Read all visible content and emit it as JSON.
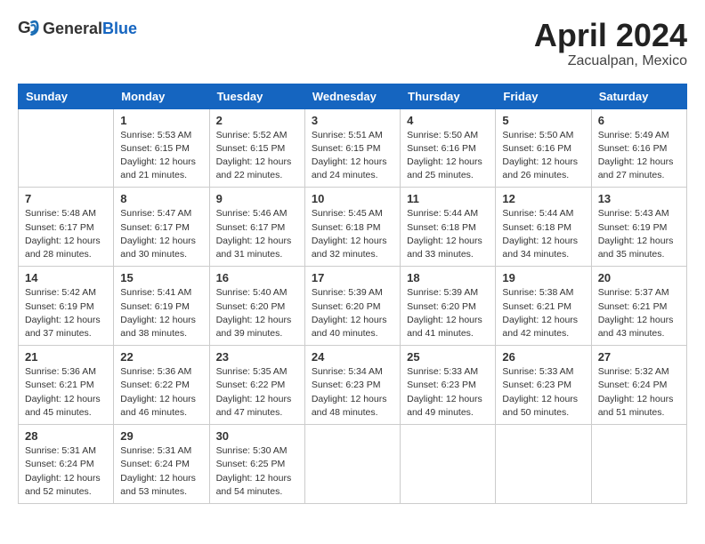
{
  "header": {
    "logo_general": "General",
    "logo_blue": "Blue",
    "month": "April 2024",
    "location": "Zacualpan, Mexico"
  },
  "weekdays": [
    "Sunday",
    "Monday",
    "Tuesday",
    "Wednesday",
    "Thursday",
    "Friday",
    "Saturday"
  ],
  "weeks": [
    [
      {
        "day": "",
        "info": ""
      },
      {
        "day": "1",
        "info": "Sunrise: 5:53 AM\nSunset: 6:15 PM\nDaylight: 12 hours\nand 21 minutes."
      },
      {
        "day": "2",
        "info": "Sunrise: 5:52 AM\nSunset: 6:15 PM\nDaylight: 12 hours\nand 22 minutes."
      },
      {
        "day": "3",
        "info": "Sunrise: 5:51 AM\nSunset: 6:15 PM\nDaylight: 12 hours\nand 24 minutes."
      },
      {
        "day": "4",
        "info": "Sunrise: 5:50 AM\nSunset: 6:16 PM\nDaylight: 12 hours\nand 25 minutes."
      },
      {
        "day": "5",
        "info": "Sunrise: 5:50 AM\nSunset: 6:16 PM\nDaylight: 12 hours\nand 26 minutes."
      },
      {
        "day": "6",
        "info": "Sunrise: 5:49 AM\nSunset: 6:16 PM\nDaylight: 12 hours\nand 27 minutes."
      }
    ],
    [
      {
        "day": "7",
        "info": "Sunrise: 5:48 AM\nSunset: 6:17 PM\nDaylight: 12 hours\nand 28 minutes."
      },
      {
        "day": "8",
        "info": "Sunrise: 5:47 AM\nSunset: 6:17 PM\nDaylight: 12 hours\nand 30 minutes."
      },
      {
        "day": "9",
        "info": "Sunrise: 5:46 AM\nSunset: 6:17 PM\nDaylight: 12 hours\nand 31 minutes."
      },
      {
        "day": "10",
        "info": "Sunrise: 5:45 AM\nSunset: 6:18 PM\nDaylight: 12 hours\nand 32 minutes."
      },
      {
        "day": "11",
        "info": "Sunrise: 5:44 AM\nSunset: 6:18 PM\nDaylight: 12 hours\nand 33 minutes."
      },
      {
        "day": "12",
        "info": "Sunrise: 5:44 AM\nSunset: 6:18 PM\nDaylight: 12 hours\nand 34 minutes."
      },
      {
        "day": "13",
        "info": "Sunrise: 5:43 AM\nSunset: 6:19 PM\nDaylight: 12 hours\nand 35 minutes."
      }
    ],
    [
      {
        "day": "14",
        "info": "Sunrise: 5:42 AM\nSunset: 6:19 PM\nDaylight: 12 hours\nand 37 minutes."
      },
      {
        "day": "15",
        "info": "Sunrise: 5:41 AM\nSunset: 6:19 PM\nDaylight: 12 hours\nand 38 minutes."
      },
      {
        "day": "16",
        "info": "Sunrise: 5:40 AM\nSunset: 6:20 PM\nDaylight: 12 hours\nand 39 minutes."
      },
      {
        "day": "17",
        "info": "Sunrise: 5:39 AM\nSunset: 6:20 PM\nDaylight: 12 hours\nand 40 minutes."
      },
      {
        "day": "18",
        "info": "Sunrise: 5:39 AM\nSunset: 6:20 PM\nDaylight: 12 hours\nand 41 minutes."
      },
      {
        "day": "19",
        "info": "Sunrise: 5:38 AM\nSunset: 6:21 PM\nDaylight: 12 hours\nand 42 minutes."
      },
      {
        "day": "20",
        "info": "Sunrise: 5:37 AM\nSunset: 6:21 PM\nDaylight: 12 hours\nand 43 minutes."
      }
    ],
    [
      {
        "day": "21",
        "info": "Sunrise: 5:36 AM\nSunset: 6:21 PM\nDaylight: 12 hours\nand 45 minutes."
      },
      {
        "day": "22",
        "info": "Sunrise: 5:36 AM\nSunset: 6:22 PM\nDaylight: 12 hours\nand 46 minutes."
      },
      {
        "day": "23",
        "info": "Sunrise: 5:35 AM\nSunset: 6:22 PM\nDaylight: 12 hours\nand 47 minutes."
      },
      {
        "day": "24",
        "info": "Sunrise: 5:34 AM\nSunset: 6:23 PM\nDaylight: 12 hours\nand 48 minutes."
      },
      {
        "day": "25",
        "info": "Sunrise: 5:33 AM\nSunset: 6:23 PM\nDaylight: 12 hours\nand 49 minutes."
      },
      {
        "day": "26",
        "info": "Sunrise: 5:33 AM\nSunset: 6:23 PM\nDaylight: 12 hours\nand 50 minutes."
      },
      {
        "day": "27",
        "info": "Sunrise: 5:32 AM\nSunset: 6:24 PM\nDaylight: 12 hours\nand 51 minutes."
      }
    ],
    [
      {
        "day": "28",
        "info": "Sunrise: 5:31 AM\nSunset: 6:24 PM\nDaylight: 12 hours\nand 52 minutes."
      },
      {
        "day": "29",
        "info": "Sunrise: 5:31 AM\nSunset: 6:24 PM\nDaylight: 12 hours\nand 53 minutes."
      },
      {
        "day": "30",
        "info": "Sunrise: 5:30 AM\nSunset: 6:25 PM\nDaylight: 12 hours\nand 54 minutes."
      },
      {
        "day": "",
        "info": ""
      },
      {
        "day": "",
        "info": ""
      },
      {
        "day": "",
        "info": ""
      },
      {
        "day": "",
        "info": ""
      }
    ]
  ]
}
